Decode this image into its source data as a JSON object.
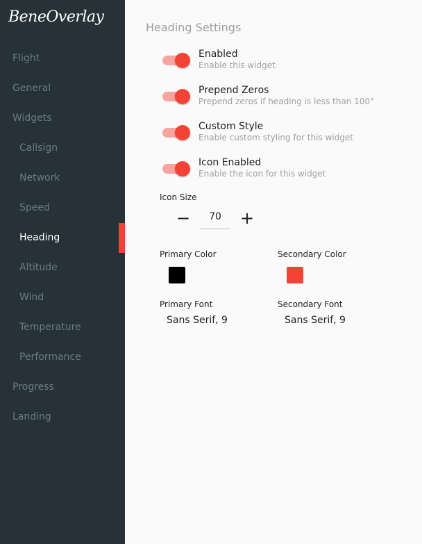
{
  "app": {
    "logo": "BeneOverlay"
  },
  "sidebar": {
    "items": [
      {
        "label": "Flight"
      },
      {
        "label": "General"
      },
      {
        "label": "Widgets"
      },
      {
        "label": "Callsign"
      },
      {
        "label": "Network"
      },
      {
        "label": "Speed"
      },
      {
        "label": "Heading"
      },
      {
        "label": "Altitude"
      },
      {
        "label": "Wind"
      },
      {
        "label": "Temperature"
      },
      {
        "label": "Performance"
      },
      {
        "label": "Progress"
      },
      {
        "label": "Landing"
      }
    ],
    "active": "Heading"
  },
  "main": {
    "title": "Heading Settings",
    "toggles": [
      {
        "label": "Enabled",
        "description": "Enable this widget",
        "on": true
      },
      {
        "label": "Prepend Zeros",
        "description": "Prepend zeros if heading is less than 100°",
        "on": true
      },
      {
        "label": "Custom Style",
        "description": "Enable custom styling for this widget",
        "on": true
      },
      {
        "label": "Icon Enabled",
        "description": "Enable the icon for this widget",
        "on": true
      }
    ],
    "icon_size": {
      "label": "Icon Size",
      "value": "70",
      "minus": "−",
      "plus": "+"
    },
    "colors": {
      "primary_label": "Primary Color",
      "primary": "#000000",
      "secondary_label": "Secondary Color",
      "secondary": "#f44336"
    },
    "fonts": {
      "primary_label": "Primary Font",
      "primary": "Sans Serif, 9",
      "secondary_label": "Secondary Font",
      "secondary": "Sans Serif, 9"
    }
  },
  "theme": {
    "accent": "#f44336",
    "sidebar_bg": "#263238"
  }
}
